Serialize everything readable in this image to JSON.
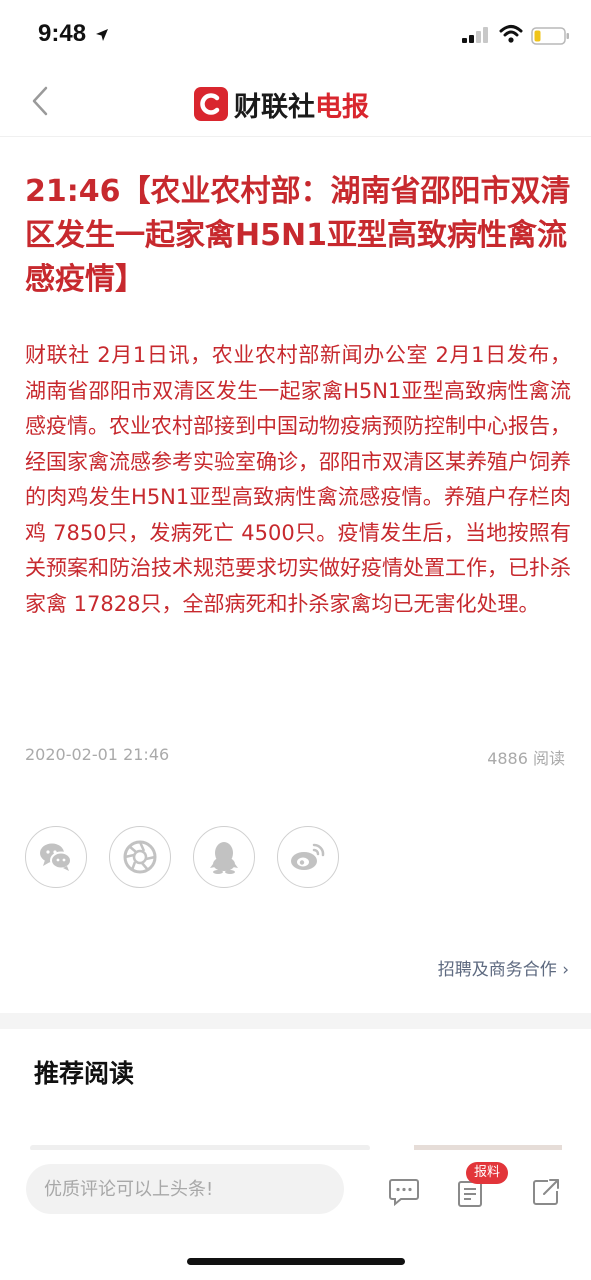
{
  "status_bar": {
    "time": "9:48"
  },
  "navbar": {
    "brand_logo_letter": "C",
    "brand_name_part1": "财联社",
    "brand_name_part2": "电报",
    "brand_color": "#d9262e"
  },
  "article": {
    "headline": "21:46【农业农村部：湖南省邵阳市双清区发生一起家禽H5N1亚型高致病性禽流感疫情】",
    "body": "财联社 2月1日讯，农业农村部新闻办公室 2月1日发布，湖南省邵阳市双清区发生一起家禽H5N1亚型高致病性禽流感疫情。农业农村部接到中国动物疫病预防控制中心报告，经国家禽流感参考实验室确诊，邵阳市双清区某养殖户饲养的肉鸡发生H5N1亚型高致病性禽流感疫情。养殖户存栏肉鸡 7850只，发病死亡 4500只。疫情发生后，当地按照有关预案和防治技术规范要求切实做好疫情处置工作，已扑杀家禽 17828只，全部病死和扑杀家禽均已无害化处理。",
    "date": "2020-02-01 21:46",
    "reads": "4886 阅读",
    "text_color": "#c7292e"
  },
  "share": {
    "icons": [
      "wechat-icon",
      "moments-icon",
      "qq-icon",
      "weibo-icon"
    ]
  },
  "links": {
    "recruit": "招聘及商务合作 ›"
  },
  "recommend": {
    "title": "推荐阅读"
  },
  "bottom_bar": {
    "comment_placeholder": "优质评论可以上头条!",
    "report_badge": "报料"
  }
}
